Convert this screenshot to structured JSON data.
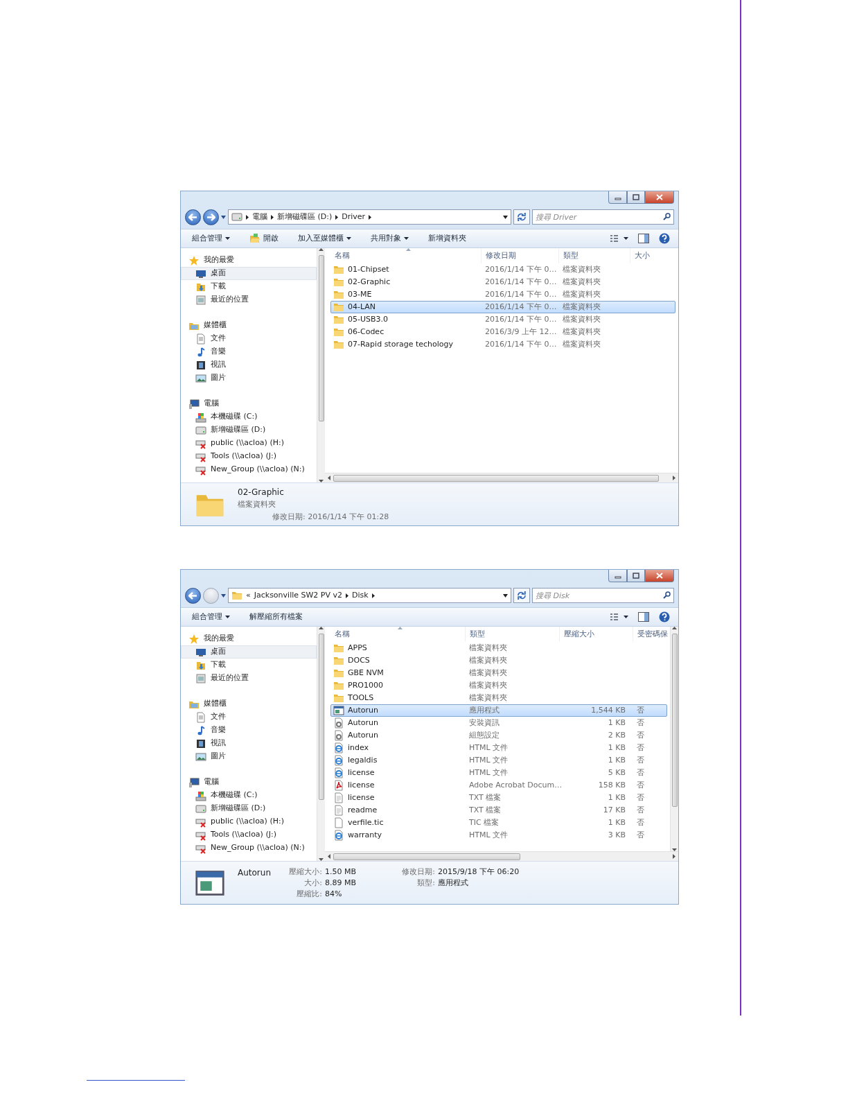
{
  "windows": [
    {
      "forward_enabled": true,
      "address": {
        "kind": "drive",
        "crumbs": [
          "電腦",
          "新增磁碟區 (D:)",
          "Driver"
        ]
      },
      "search": {
        "placeholder": "搜尋 Driver"
      },
      "toolbar": [
        {
          "label": "組合管理",
          "kind": "plain",
          "menu": true
        },
        {
          "label": "開啟",
          "kind": "open",
          "menu": false
        },
        {
          "label": "加入至媒體櫃",
          "kind": "plain",
          "menu": true
        },
        {
          "label": "共用對象",
          "kind": "plain",
          "menu": true
        },
        {
          "label": "新增資料夾",
          "kind": "plain",
          "menu": false
        }
      ],
      "sidebar": [
        {
          "label": "我的最愛",
          "kind": "star",
          "children": [
            {
              "label": "桌面",
              "kind": "desktop",
              "selected": true
            },
            {
              "label": "下載",
              "kind": "download",
              "selected": false
            },
            {
              "label": "最近的位置",
              "kind": "recent",
              "selected": false
            }
          ]
        },
        {
          "label": "媒體櫃",
          "kind": "library",
          "children": [
            {
              "label": "文件",
              "kind": "document",
              "selected": false
            },
            {
              "label": "音樂",
              "kind": "music",
              "selected": false
            },
            {
              "label": "視訊",
              "kind": "video",
              "selected": false
            },
            {
              "label": "圖片",
              "kind": "picture",
              "selected": false
            }
          ]
        },
        {
          "label": "電腦",
          "kind": "computer",
          "children": [
            {
              "label": "本機磁碟 (C:)",
              "kind": "system-drive",
              "selected": false
            },
            {
              "label": "新增磁碟區 (D:)",
              "kind": "drive",
              "selected": false
            },
            {
              "label": "public (\\\\acloa) (H:)",
              "kind": "network-drive",
              "selected": false
            },
            {
              "label": "Tools (\\\\acloa) (J:)",
              "kind": "network-drive",
              "selected": false
            },
            {
              "label": "New_Group (\\\\acloa) (N:)",
              "kind": "network-drive",
              "selected": false
            }
          ]
        }
      ],
      "columns": [
        {
          "label": "名稱",
          "sorted": true
        },
        {
          "label": "修改日期",
          "sorted": false
        },
        {
          "label": "類型",
          "sorted": false
        },
        {
          "label": "大小",
          "sorted": false
        }
      ],
      "vertical_scrollbar": false,
      "rows": [
        {
          "kind": "folder",
          "selected": false,
          "cells": [
            "01-Chipset",
            "2016/1/14 下午 0…",
            "檔案資料夾"
          ]
        },
        {
          "kind": "folder",
          "selected": false,
          "cells": [
            "02-Graphic",
            "2016/1/14 下午 0…",
            "檔案資料夾"
          ]
        },
        {
          "kind": "folder",
          "selected": false,
          "cells": [
            "03-ME",
            "2016/1/14 下午 0…",
            "檔案資料夾"
          ]
        },
        {
          "kind": "folder",
          "selected": true,
          "cells": [
            "04-LAN",
            "2016/1/14 下午 0…",
            "檔案資料夾"
          ]
        },
        {
          "kind": "folder",
          "selected": false,
          "cells": [
            "05-USB3.0",
            "2016/1/14 下午 0…",
            "檔案資料夾"
          ]
        },
        {
          "kind": "folder",
          "selected": false,
          "cells": [
            "06-Codec",
            "2016/3/9 上午 12…",
            "檔案資料夾"
          ]
        },
        {
          "kind": "folder",
          "selected": false,
          "cells": [
            "07-Rapid storage techology",
            "2016/1/14 下午 0…",
            "檔案資料夾"
          ]
        }
      ],
      "details": {
        "kind": "folder",
        "name": "02-Graphic",
        "columns": [
          [
            {
              "value": "檔案資料夾"
            },
            {
              "label": "修改日期:",
              "value": "2016/1/14 下午 01:28"
            }
          ]
        ]
      }
    },
    {
      "forward_enabled": false,
      "address": {
        "kind": "folder",
        "overflow_mark": "«",
        "crumbs": [
          "Jacksonville SW2 PV v2",
          "Disk"
        ]
      },
      "search": {
        "placeholder": "搜尋 Disk"
      },
      "toolbar": [
        {
          "label": "組合管理",
          "kind": "plain",
          "menu": true
        },
        {
          "label": "解壓縮所有檔案",
          "kind": "plain",
          "menu": false
        }
      ],
      "sidebar": [
        {
          "label": "我的最愛",
          "kind": "star",
          "children": [
            {
              "label": "桌面",
              "kind": "desktop",
              "selected": true
            },
            {
              "label": "下載",
              "kind": "download",
              "selected": false
            },
            {
              "label": "最近的位置",
              "kind": "recent",
              "selected": false
            }
          ]
        },
        {
          "label": "媒體櫃",
          "kind": "library",
          "children": [
            {
              "label": "文件",
              "kind": "document",
              "selected": false
            },
            {
              "label": "音樂",
              "kind": "music",
              "selected": false
            },
            {
              "label": "視訊",
              "kind": "video",
              "selected": false
            },
            {
              "label": "圖片",
              "kind": "picture",
              "selected": false
            }
          ]
        },
        {
          "label": "電腦",
          "kind": "computer",
          "children": [
            {
              "label": "本機磁碟 (C:)",
              "kind": "system-drive",
              "selected": false
            },
            {
              "label": "新增磁碟區 (D:)",
              "kind": "drive",
              "selected": false
            },
            {
              "label": "public (\\\\acloa) (H:)",
              "kind": "network-drive",
              "selected": false
            },
            {
              "label": "Tools (\\\\acloa) (J:)",
              "kind": "network-drive",
              "selected": false
            },
            {
              "label": "New_Group (\\\\acloa) (N:)",
              "kind": "network-drive",
              "selected": false
            }
          ]
        }
      ],
      "columns": [
        {
          "label": "名稱",
          "sorted": true
        },
        {
          "label": "類型",
          "sorted": false
        },
        {
          "label": "壓縮大小",
          "sorted": false
        },
        {
          "label": "受密碼保",
          "sorted": false
        }
      ],
      "vertical_scrollbar": true,
      "rows": [
        {
          "kind": "folder",
          "selected": false,
          "cells": [
            "APPS",
            "檔案資料夾"
          ]
        },
        {
          "kind": "folder",
          "selected": false,
          "cells": [
            "DOCS",
            "檔案資料夾"
          ]
        },
        {
          "kind": "folder",
          "selected": false,
          "cells": [
            "GBE NVM",
            "檔案資料夾"
          ]
        },
        {
          "kind": "folder",
          "selected": false,
          "cells": [
            "PRO1000",
            "檔案資料夾"
          ]
        },
        {
          "kind": "folder",
          "selected": false,
          "cells": [
            "TOOLS",
            "檔案資料夾"
          ]
        },
        {
          "kind": "application",
          "selected": true,
          "cells": [
            "Autorun",
            "應用程式",
            "1,544 KB",
            "否"
          ]
        },
        {
          "kind": "setup",
          "selected": false,
          "cells": [
            "Autorun",
            "安裝資訊",
            "1 KB",
            "否"
          ]
        },
        {
          "kind": "setup",
          "selected": false,
          "cells": [
            "Autorun",
            "組態設定",
            "2 KB",
            "否"
          ]
        },
        {
          "kind": "html",
          "selected": false,
          "cells": [
            "index",
            "HTML 文件",
            "1 KB",
            "否"
          ]
        },
        {
          "kind": "html",
          "selected": false,
          "cells": [
            "legaldis",
            "HTML 文件",
            "1 KB",
            "否"
          ]
        },
        {
          "kind": "html",
          "selected": false,
          "cells": [
            "license",
            "HTML 文件",
            "5 KB",
            "否"
          ]
        },
        {
          "kind": "pdf",
          "selected": false,
          "cells": [
            "license",
            "Adobe Acrobat Docum…",
            "158 KB",
            "否"
          ]
        },
        {
          "kind": "text",
          "selected": false,
          "cells": [
            "license",
            "TXT 檔案",
            "1 KB",
            "否"
          ]
        },
        {
          "kind": "text",
          "selected": false,
          "cells": [
            "readme",
            "TXT 檔案",
            "17 KB",
            "否"
          ]
        },
        {
          "kind": "file",
          "selected": false,
          "cells": [
            "verfile.tic",
            "TIC 檔案",
            "1 KB",
            "否"
          ]
        },
        {
          "kind": "html",
          "selected": false,
          "cells": [
            "warranty",
            "HTML 文件",
            "3 KB",
            "否"
          ]
        }
      ],
      "details": {
        "kind": "application",
        "name": "Autorun",
        "columns": [
          [
            {
              "label": "壓縮大小:",
              "value": "1.50 MB"
            },
            {
              "label": "大小:",
              "value": "8.89 MB"
            },
            {
              "label": "壓縮比:",
              "value": "84%"
            }
          ],
          [
            {
              "label": "修改日期:",
              "value": "2015/9/18 下午 06:20"
            },
            {
              "label": "類型:",
              "value": "應用程式"
            }
          ]
        ]
      }
    }
  ]
}
